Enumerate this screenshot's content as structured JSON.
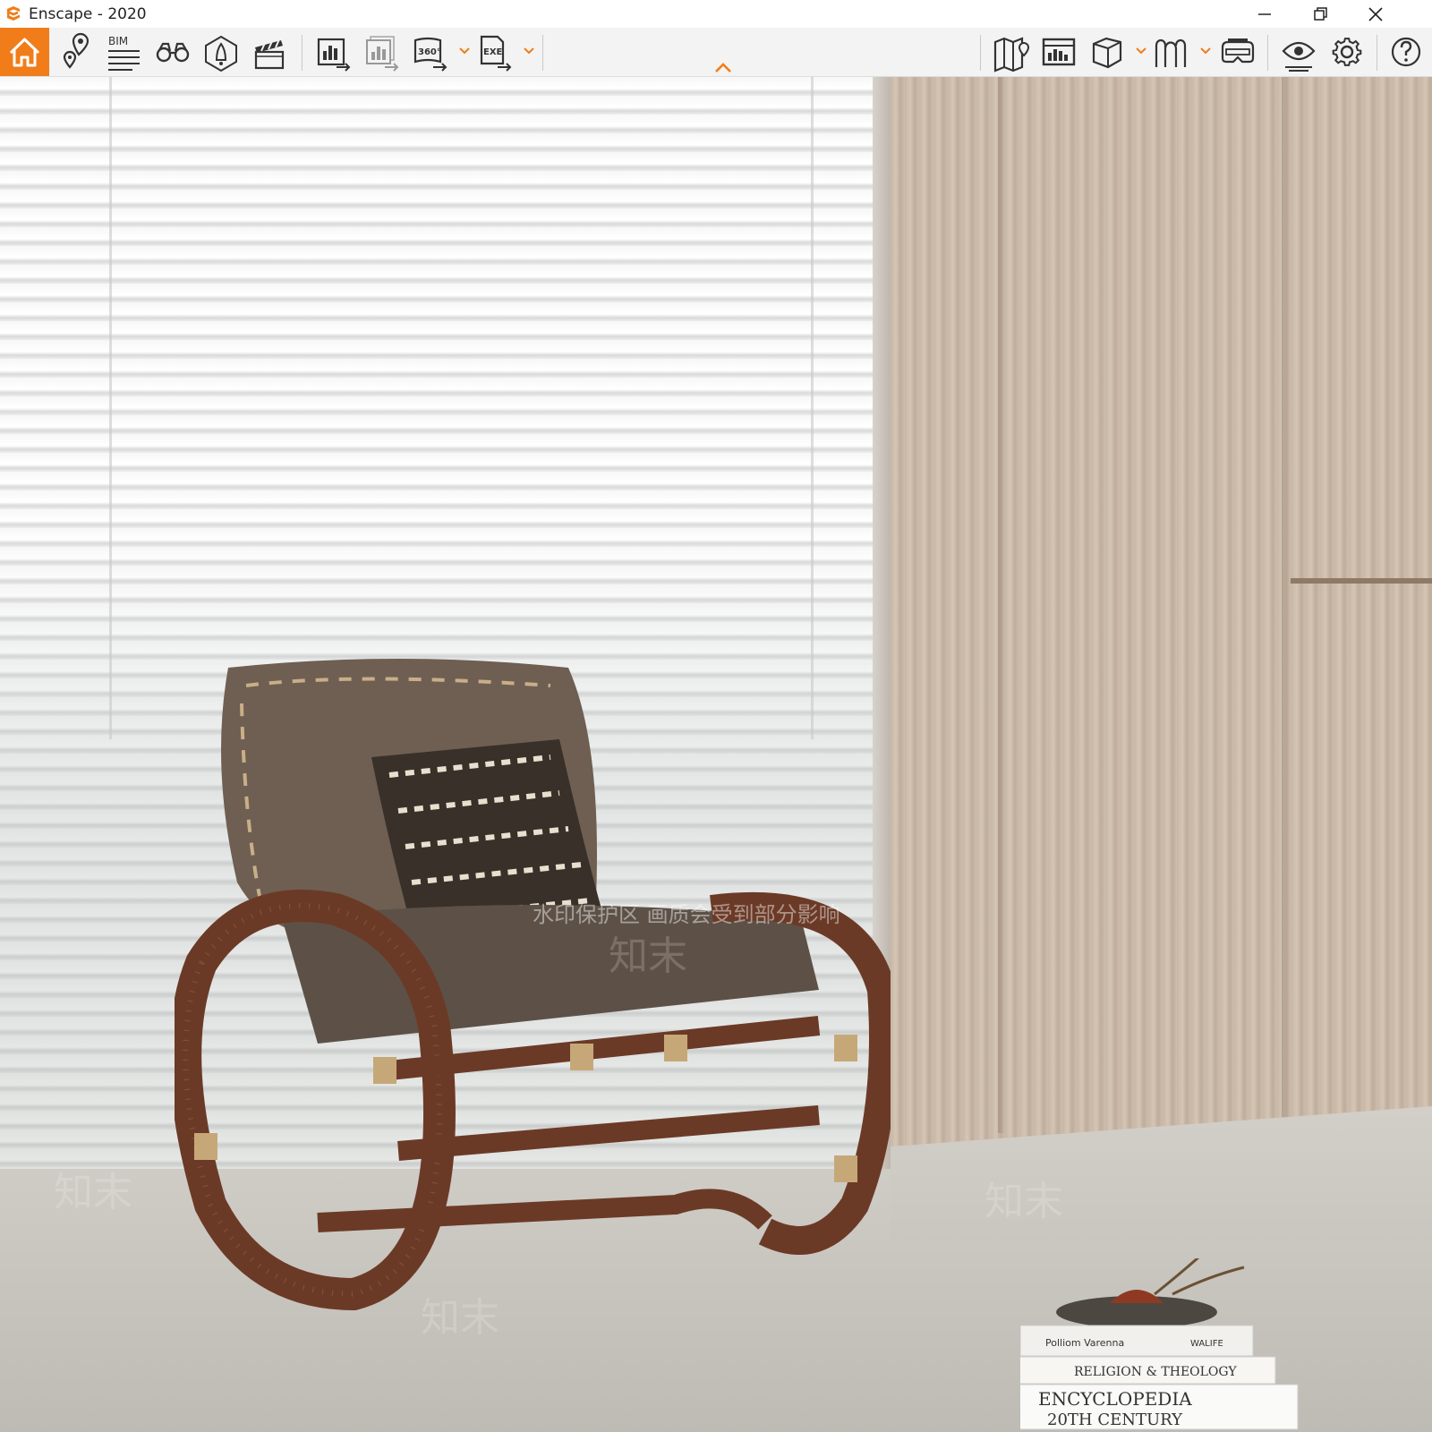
{
  "window": {
    "title": "Enscape - 2020",
    "controls": [
      "minimize-icon",
      "restore-icon",
      "close-icon"
    ]
  },
  "toolbar": {
    "accent_color": "#f07d1a",
    "left_tools": [
      {
        "icon": "home-icon",
        "active": true
      },
      {
        "icon": "location-pin-icon"
      },
      {
        "icon": "bim-icon",
        "label": "BIM"
      },
      {
        "icon": "binoculars-icon"
      },
      {
        "icon": "light-view-icon"
      },
      {
        "icon": "video-clapper-icon"
      },
      {
        "icon": "render-screenshot-icon"
      },
      {
        "icon": "batch-render-icon"
      },
      {
        "icon": "panorama-360-icon",
        "label": "360°"
      },
      {
        "icon": "export-exe-icon",
        "label": "EXE"
      }
    ],
    "right_tools": [
      {
        "icon": "map-icon"
      },
      {
        "icon": "asset-library-icon"
      },
      {
        "icon": "cube-icon"
      },
      {
        "icon": "material-icon"
      },
      {
        "icon": "vr-headset-icon"
      },
      {
        "icon": "visual-settings-eye-icon"
      },
      {
        "icon": "settings-gear-icon"
      },
      {
        "icon": "help-icon"
      }
    ]
  },
  "scene": {
    "books_spines": [
      "Polliom Varenna",
      "WALIFE",
      "RELIGION & THEOLOGY",
      "ENCYCLOPEDIA",
      "20TH CENTURY"
    ],
    "watermark_caption": "水印保护区 画质会受到部分影响",
    "watermark_tile": "知末"
  }
}
